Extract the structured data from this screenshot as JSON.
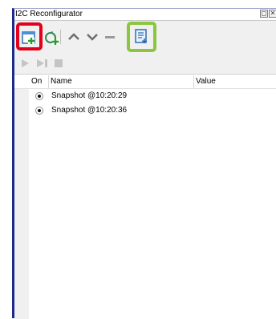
{
  "window": {
    "title": "I2C Reconfigurator"
  },
  "table": {
    "columns": [
      "On",
      "Name",
      "Value"
    ],
    "rows": [
      {
        "on": true,
        "name": "Snapshot @10:20:29",
        "value": ""
      },
      {
        "on": true,
        "name": "Snapshot @10:20:36",
        "value": ""
      }
    ]
  },
  "toolbar": {
    "icons": [
      "add-snapshot-icon",
      "refresh-add-icon",
      "move-up-icon",
      "move-down-icon",
      "remove-icon",
      "export-list-icon"
    ],
    "playback_icons": [
      "play-icon",
      "play-next-icon",
      "stop-icon"
    ]
  },
  "colors": {
    "highlight_red": "#e3001b",
    "highlight_green": "#8cc63f",
    "frame_blue": "#1b2a8c"
  }
}
